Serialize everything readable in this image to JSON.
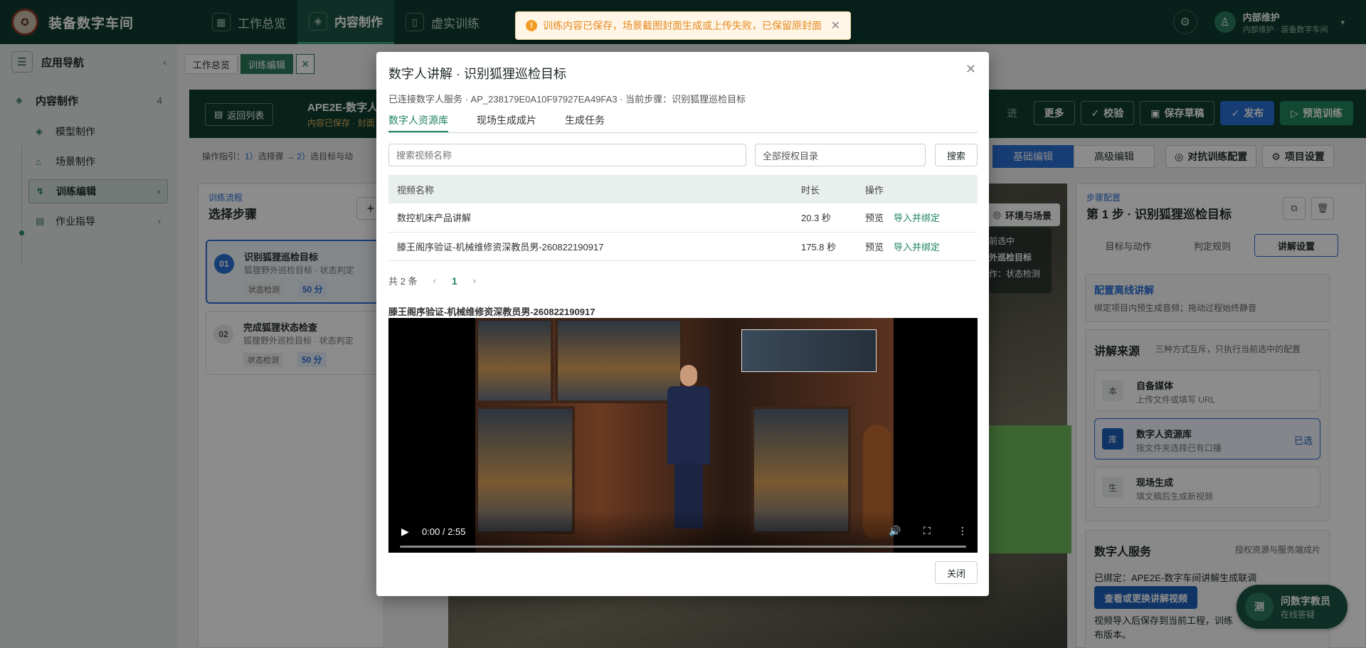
{
  "app": {
    "title": "装备数字车间",
    "logo_icon": "emblem-icon"
  },
  "top_nav": [
    {
      "label": "工作总览",
      "icon": "grid-icon"
    },
    {
      "label": "内容制作",
      "icon": "cube-icon",
      "active": true
    },
    {
      "label": "虚实训练",
      "icon": "book-icon"
    }
  ],
  "user": {
    "name": "内部维护",
    "sub": "内部维护 · 装备数字车间"
  },
  "sidebar": {
    "title": "应用导航",
    "group": {
      "label": "内容制作",
      "count": "4"
    },
    "items": [
      {
        "label": "模型制作",
        "icon": "cube-icon"
      },
      {
        "label": "场景制作",
        "icon": "home-icon"
      },
      {
        "label": "训练编辑",
        "icon": "flow-icon",
        "active": true
      },
      {
        "label": "作业指导",
        "icon": "doc-icon"
      }
    ]
  },
  "tabs": {
    "overview": "工作总览",
    "editor": "训练编辑"
  },
  "banner": {
    "back": "返回列表",
    "project": "APE2E-数字人",
    "sub": "内容已保存 · 封面",
    "faded_btn": "进",
    "more": "更多",
    "check": "校验",
    "save": "保存草稿",
    "publish": "发布",
    "preview": "预览训练"
  },
  "guide": {
    "prefix": "操作指引：",
    "step1": "1）",
    "text1": "选择骤 → ",
    "step2": "2）",
    "text2": "选目标与动"
  },
  "modes": {
    "basic": "基础编辑",
    "advanced": "高级编辑"
  },
  "tools": {
    "adversarial": "对抗训练配置",
    "project": "项目设置"
  },
  "steps_panel": {
    "label": "训练流程",
    "title": "选择步骤",
    "steps": [
      {
        "no": "01",
        "title": "识别狐狸巡检目标",
        "sub": "狐狸野外巡检目标 · 状态判定",
        "tag": "状态检测",
        "score": "50 分"
      },
      {
        "no": "02",
        "title": "完成狐狸状态检查",
        "sub": "狐狸野外巡检目标 · 状态判定",
        "tag": "状态检测",
        "score": "50 分"
      }
    ]
  },
  "scene": {
    "env_btn": "环境与场景",
    "card_line1": "当前选中",
    "card_line2": "野外巡检目标",
    "card_line3": "动作：状态检测"
  },
  "config": {
    "label": "步骤配置",
    "title": "第 1 步 · 识别狐狸巡检目标",
    "tabs": [
      "目标与动作",
      "判定规则",
      "讲解设置"
    ],
    "offline": {
      "title": "配置离线讲解",
      "desc": "绑定项目内预生成音频；拖动过程始终静音"
    },
    "source": {
      "title": "讲解来源",
      "hint": "三种方式互斥，只执行当前选中的配置",
      "options": [
        {
          "icon": "本",
          "title": "自备媒体",
          "desc": "上传文件或填写 URL"
        },
        {
          "icon": "库",
          "title": "数字人资源库",
          "desc": "按文件夹选择已有口播",
          "selected": "已选"
        },
        {
          "icon": "生",
          "title": "现场生成",
          "desc": "填文稿后生成新视频"
        }
      ]
    },
    "service": {
      "title": "数字人服务",
      "hint": "授权资源与服务端成片",
      "bound": "已绑定：APE2E-数字车间讲解生成联调",
      "btn": "查看或更换讲解视频",
      "note1": "视频导入后保存到当前工程，训练",
      "note2": "布版本。"
    }
  },
  "float_help": {
    "avatar": "测",
    "title": "问数字教员",
    "status": "在线答疑"
  },
  "toast": {
    "text": "训练内容已保存，场景截图封面生成或上传失败，已保留原封面"
  },
  "modal": {
    "title": "数字人讲解 · 识别狐狸巡检目标",
    "info": "已连接数字人服务 · AP_238179E0A10F97927EA49FA3 · 当前步骤：识别狐狸巡检目标",
    "tabs": [
      "数字人资源库",
      "现场生成成片",
      "生成任务"
    ],
    "search_placeholder": "搜索视频名称",
    "dir": "全部授权目录",
    "search_btn": "搜索",
    "columns": {
      "name": "视频名称",
      "duration": "时长",
      "action": "操作"
    },
    "rows": [
      {
        "name": "数控机床产品讲解",
        "duration": "20.3 秒",
        "preview": "预览",
        "import": "导入并绑定"
      },
      {
        "name": "滕王阁序验证-机械维修资深教员男-260822190917",
        "duration": "175.8 秒",
        "preview": "预览",
        "import": "导入并绑定"
      }
    ],
    "total": "共 2 条",
    "page": "1",
    "video_title": "滕王阁序验证-机械维修资深教员男-260822190917",
    "video_time": "0:00 / 2:55",
    "close": "关闭"
  }
}
